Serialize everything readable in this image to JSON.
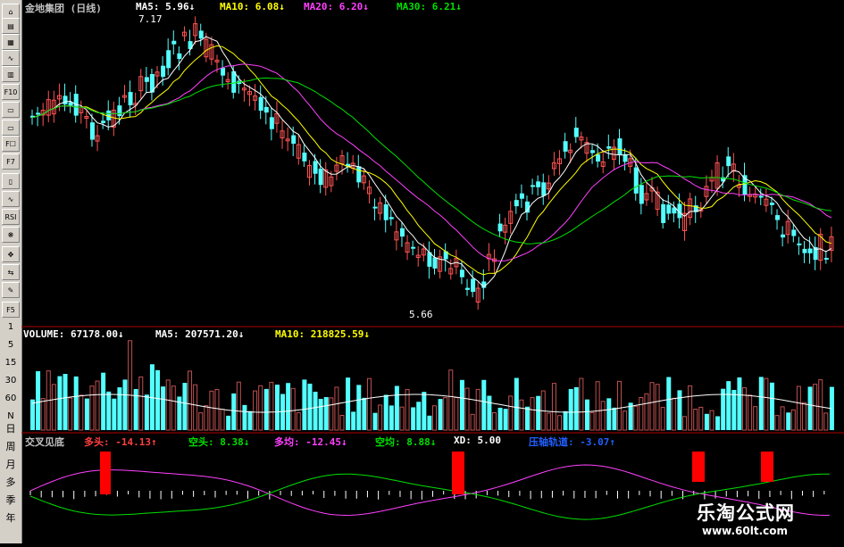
{
  "toolbar": {
    "buttons": [
      "⌂",
      "▤",
      "▦",
      "∿",
      "▥",
      "F10",
      "▭",
      "▭",
      "F☐",
      "F7",
      "▯",
      "∿",
      "RSI",
      "❋",
      "✥",
      "⇆",
      "✎",
      "F5"
    ],
    "scale_labels": [
      "1",
      "5",
      "15",
      "30",
      "60",
      "N"
    ],
    "period_labels": [
      "日",
      "周",
      "月",
      "多",
      "季",
      "年"
    ]
  },
  "header": {
    "title": "金地集团 (日线)",
    "ma5": "MA5: 5.96↓",
    "ma10": "MA10: 6.08↓",
    "ma20": "MA20: 6.20↓",
    "ma30": "MA30: 6.21↓"
  },
  "price_panel": {
    "high_label": "7.17",
    "low_label": "5.66"
  },
  "volume_header": {
    "volume": "VOLUME: 67178.00↓",
    "ma5": "MA5: 207571.20↓",
    "ma10": "MA10: 218825.59↓"
  },
  "indicator_header": {
    "name": "交叉见底",
    "duotou": "多头: -14.13↑",
    "kongtou": "空头: 8.38↓",
    "duojun": "多均: -12.45↓",
    "kongjun": "空均: 8.88↓",
    "xd": "XD: 5.00",
    "yazhi": "压轴轨道: -3.07↑"
  },
  "watermark": {
    "name": "乐淘公式网",
    "url": "www.60lt.com"
  },
  "colors": {
    "up": "#ff5252",
    "down": "#54ffff",
    "ma5": "#ffffff",
    "ma10": "#ffff00",
    "ma20": "#ff40ff",
    "ma30": "#00e000",
    "title": "#c0c0c0",
    "signal": "#ff0000"
  }
}
